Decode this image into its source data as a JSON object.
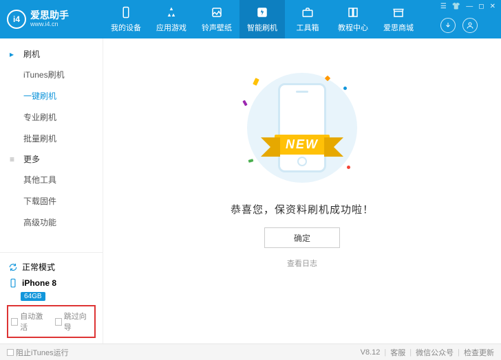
{
  "brand": {
    "title": "爱思助手",
    "subtitle": "www.i4.cn",
    "logo_text": "i4"
  },
  "header": {
    "tabs": [
      {
        "label": "我的设备"
      },
      {
        "label": "应用游戏"
      },
      {
        "label": "铃声壁纸"
      },
      {
        "label": "智能刷机"
      },
      {
        "label": "工具箱"
      },
      {
        "label": "教程中心"
      },
      {
        "label": "爱思商城"
      }
    ]
  },
  "sidebar": {
    "group1_title": "刷机",
    "group1_items": [
      "iTunes刷机",
      "一键刷机",
      "专业刷机",
      "批量刷机"
    ],
    "group2_title": "更多",
    "group2_items": [
      "其他工具",
      "下载固件",
      "高级功能"
    ],
    "mode_label": "正常模式",
    "device_name": "iPhone 8",
    "storage": "64GB",
    "cb_auto_activate": "自动激活",
    "cb_skip_wizard": "跳过向导"
  },
  "main": {
    "ribbon_text": "NEW",
    "success_text": "恭喜您，保资料刷机成功啦！",
    "ok_button": "确定",
    "log_link": "查看日志"
  },
  "footer": {
    "block_itunes": "阻止iTunes运行",
    "version": "V8.12",
    "customer_service": "客服",
    "wechat": "微信公众号",
    "check_update": "检查更新"
  }
}
